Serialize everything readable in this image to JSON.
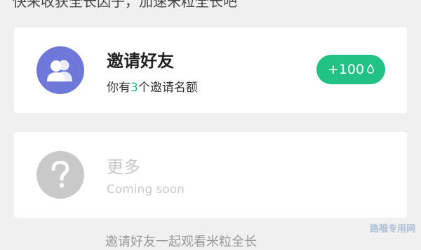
{
  "top_hint": "快来收获全长因子，加速米粒全长吧",
  "invite_card": {
    "title": "邀请好友",
    "subtitle_pre": "你有",
    "subtitle_count": "3",
    "subtitle_post": "个邀请名额",
    "reward_label": "+100",
    "icon": "people-icon"
  },
  "more_card": {
    "title": "更多",
    "subtitle": "Coming soon",
    "icon": "question-icon"
  },
  "bottom_hint": "邀请好友一起观看米粒全长",
  "watermark": "路哦专用网",
  "colors": {
    "accent_green": "#22c184",
    "avatar_purple": "#6f78d8",
    "avatar_grey": "#c9c9c9"
  }
}
